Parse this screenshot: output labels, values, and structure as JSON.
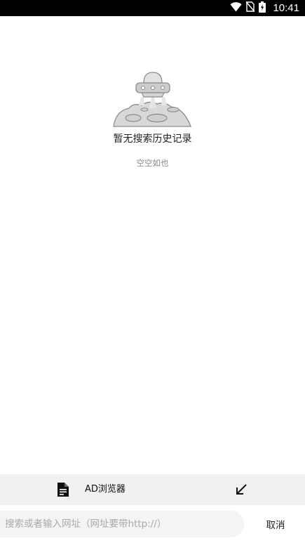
{
  "status_bar": {
    "time": "10:41",
    "icons": [
      "wifi-icon",
      "no-sim-icon",
      "battery-charging-icon"
    ]
  },
  "empty_state": {
    "illustration": "ufo-over-planet-illustration",
    "title": "暂无搜索历史记录",
    "subtitle": "空空如也"
  },
  "toolbar": {
    "doc_icon": "document-icon",
    "label": "AD浏览器",
    "arrow_icon": "arrow-down-left-icon"
  },
  "search": {
    "placeholder": "搜索或者输入网址（网址要带http://）",
    "value": "",
    "cancel_label": "取消"
  },
  "colors": {
    "status_bar": "#000000",
    "toolbar_bg": "#f1f1f1",
    "search_bg": "#f4f4f4",
    "illustration_gray": "#9a9a9a"
  }
}
